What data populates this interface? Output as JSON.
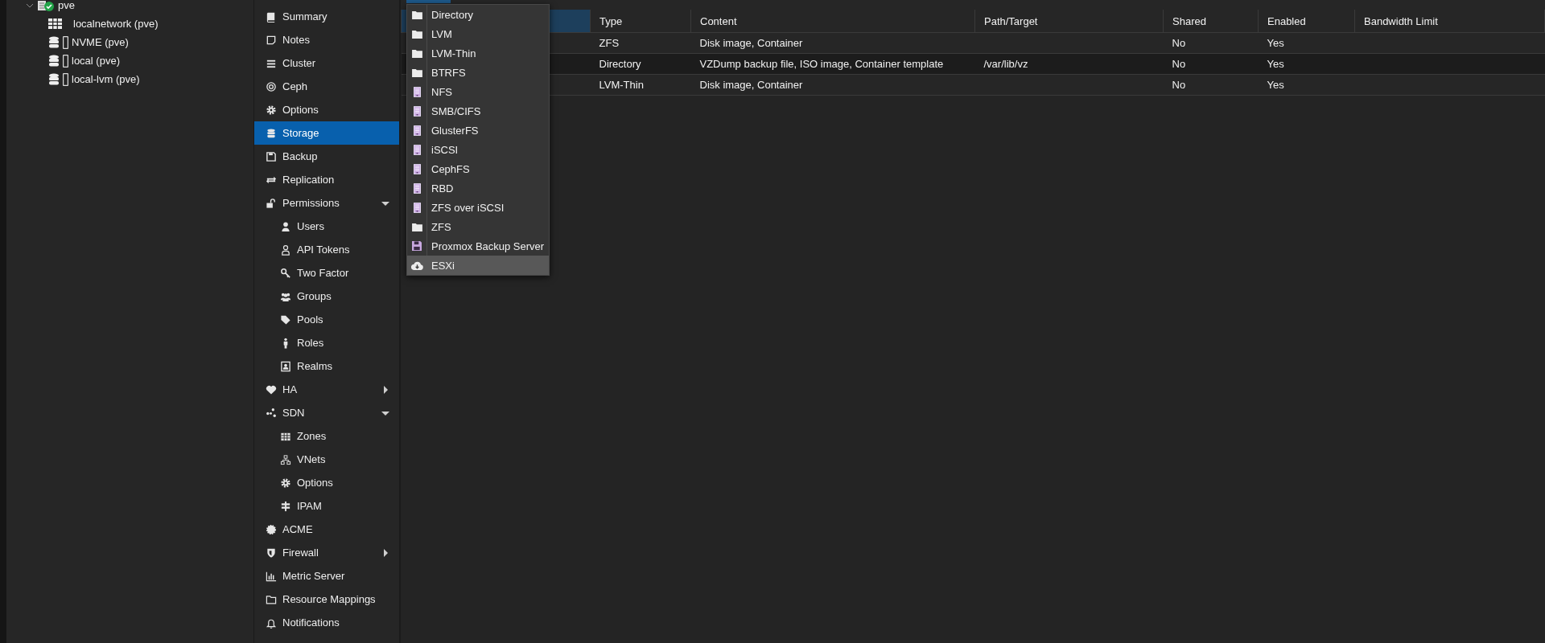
{
  "tree": [
    {
      "label": "pve",
      "expanded": true,
      "children": [
        {
          "label": "localnetwork (pve)"
        },
        {
          "label": "NVME (pve)"
        },
        {
          "label": "local (pve)"
        },
        {
          "label": "local-lvm (pve)"
        }
      ]
    }
  ],
  "sidebar": {
    "items": [
      {
        "label": "Summary",
        "selected": false
      },
      {
        "label": "Notes",
        "selected": false
      },
      {
        "label": "Cluster",
        "selected": false
      },
      {
        "label": "Ceph",
        "selected": false
      },
      {
        "label": "Options",
        "selected": false
      },
      {
        "label": "Storage",
        "selected": true
      },
      {
        "label": "Backup",
        "selected": false
      },
      {
        "label": "Replication",
        "selected": false
      },
      {
        "label": "Permissions",
        "selected": false,
        "expanded": true,
        "children": [
          {
            "label": "Users",
            "selected": false
          },
          {
            "label": "API Tokens",
            "selected": false
          },
          {
            "label": "Two Factor",
            "selected": false
          },
          {
            "label": "Groups",
            "selected": false
          },
          {
            "label": "Pools",
            "selected": false
          },
          {
            "label": "Roles",
            "selected": false
          },
          {
            "label": "Realms",
            "selected": false
          }
        ]
      },
      {
        "label": "HA",
        "selected": false,
        "expanded": false
      },
      {
        "label": "SDN",
        "selected": false,
        "expanded": true,
        "children": [
          {
            "label": "Zones",
            "selected": false
          },
          {
            "label": "VNets",
            "selected": false
          },
          {
            "label": "Options",
            "selected": false
          },
          {
            "label": "IPAM",
            "selected": false
          }
        ]
      },
      {
        "label": "ACME",
        "selected": false
      },
      {
        "label": "Firewall",
        "selected": false,
        "expanded": false
      },
      {
        "label": "Metric Server",
        "selected": false
      },
      {
        "label": "Resource Mappings",
        "selected": false
      },
      {
        "label": "Notifications",
        "selected": false
      }
    ]
  },
  "table": {
    "columns": [
      "Type",
      "Content",
      "Path/Target",
      "Shared",
      "Enabled",
      "Bandwidth Limit"
    ],
    "rows": [
      {
        "type": "ZFS",
        "content": "Disk image, Container",
        "path": "",
        "shared": "No",
        "enabled": "Yes"
      },
      {
        "type": "Directory",
        "content": "VZDump backup file, ISO image, Container template",
        "path": "/var/lib/vz",
        "shared": "No",
        "enabled": "Yes"
      },
      {
        "type": "LVM-Thin",
        "content": "Disk image, Container",
        "path": "",
        "shared": "No",
        "enabled": "Yes"
      }
    ]
  },
  "add_menu": {
    "items": [
      {
        "label": "Directory",
        "kind": "folder",
        "selected": false
      },
      {
        "label": "LVM",
        "kind": "folder",
        "selected": false
      },
      {
        "label": "LVM-Thin",
        "kind": "folder",
        "selected": false
      },
      {
        "label": "BTRFS",
        "kind": "folder",
        "selected": false
      },
      {
        "label": "NFS",
        "kind": "server",
        "selected": false
      },
      {
        "label": "SMB/CIFS",
        "kind": "server",
        "selected": false
      },
      {
        "label": "GlusterFS",
        "kind": "server",
        "selected": false
      },
      {
        "label": "iSCSI",
        "kind": "server",
        "selected": false
      },
      {
        "label": "CephFS",
        "kind": "server",
        "selected": false
      },
      {
        "label": "RBD",
        "kind": "server",
        "selected": false
      },
      {
        "label": "ZFS over iSCSI",
        "kind": "server",
        "selected": false
      },
      {
        "label": "ZFS",
        "kind": "folder",
        "selected": false
      },
      {
        "label": "Proxmox Backup Server",
        "kind": "floppy",
        "selected": false
      },
      {
        "label": "ESXi",
        "kind": "cloud",
        "selected": true
      }
    ]
  }
}
